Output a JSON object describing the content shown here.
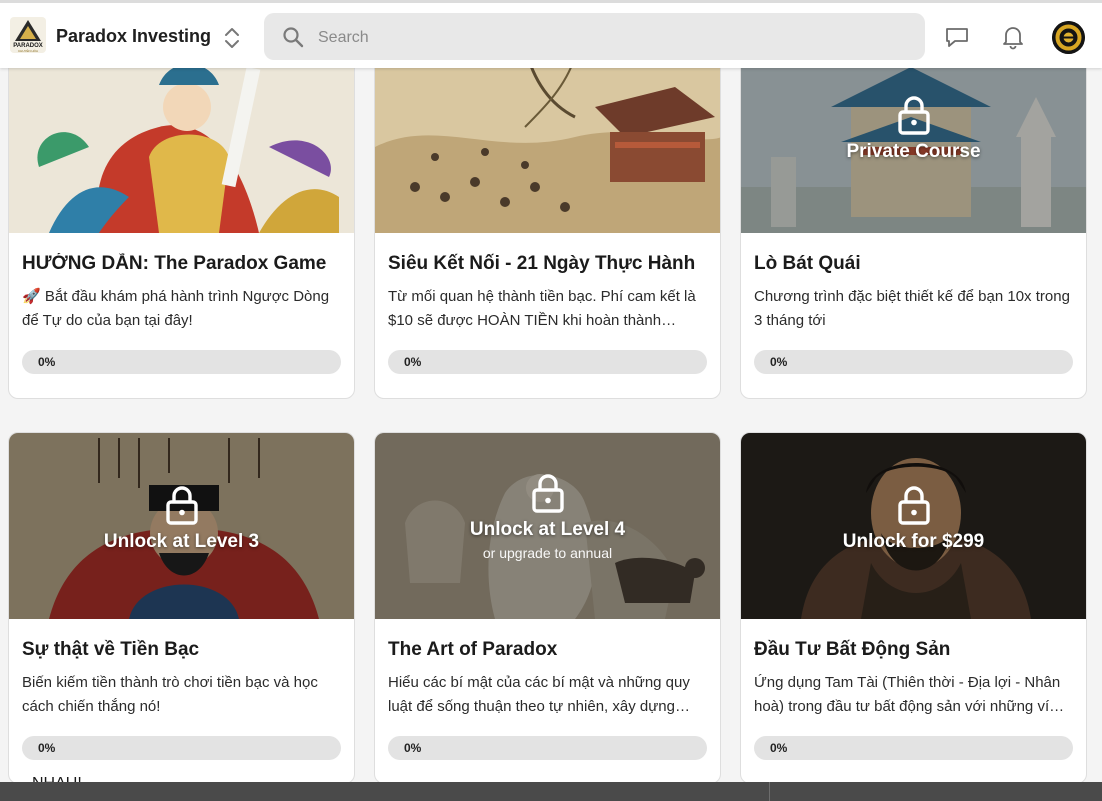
{
  "header": {
    "group_name": "Paradox Investing",
    "logo_text": "PARADOX",
    "logo_subtext": "CHUYỂN HÓA",
    "search_placeholder": "Search",
    "icons": [
      "chat-icon",
      "bell-icon",
      "avatar"
    ]
  },
  "colors": {
    "accent": "#c9a84c",
    "progress_track": "#e3e3e3",
    "page_bg": "#f4f4f4"
  },
  "courses": [
    {
      "title": "HƯỚNG DẪN: The Paradox Game",
      "description": "🚀 Bắt đầu khám phá hành trình Ngược Dòng để Tự do của bạn tại đây!",
      "progress_label": "0%",
      "progress": 0,
      "locked": false
    },
    {
      "title": "Siêu Kết Nối - 21 Ngày Thực Hành",
      "description": "Từ mối quan hệ thành tiền bạc. Phí cam kết là $10 sẽ được HOÀN TIỀN khi hoàn thành…",
      "progress_label": "0%",
      "progress": 0,
      "locked": false
    },
    {
      "title": "Lò Bát Quái",
      "description": "Chương trình đặc biệt thiết kế để bạn 10x trong 3 tháng tới",
      "progress_label": "0%",
      "progress": 0,
      "locked": true,
      "lock_text": "Private Course"
    },
    {
      "title": "Sự thật về Tiền Bạc",
      "description": "Biến kiếm tiền thành trò chơi tiền bạc và học cách chiến thắng nó!",
      "progress_label": "0%",
      "progress": 0,
      "locked": true,
      "lock_text": "Unlock at Level 3"
    },
    {
      "title": "The Art of Paradox",
      "description": "Hiểu các bí mật của các bí mật và những quy luật để sống thuận theo tự nhiên, xây dựng…",
      "progress_label": "0%",
      "progress": 0,
      "locked": true,
      "lock_text": "Unlock at Level 4",
      "lock_subtext": "or upgrade to annual"
    },
    {
      "title": "Đầu Tư Bất Động Sản",
      "description": "Ứng dụng Tam Tài (Thiên thời - Địa lợi - Nhân hoà) trong đầu tư bất động sản với những ví…",
      "progress_label": "0%",
      "progress": 0,
      "locked": true,
      "lock_text": "Unlock for $299"
    }
  ],
  "footer_text": "NHAU!"
}
